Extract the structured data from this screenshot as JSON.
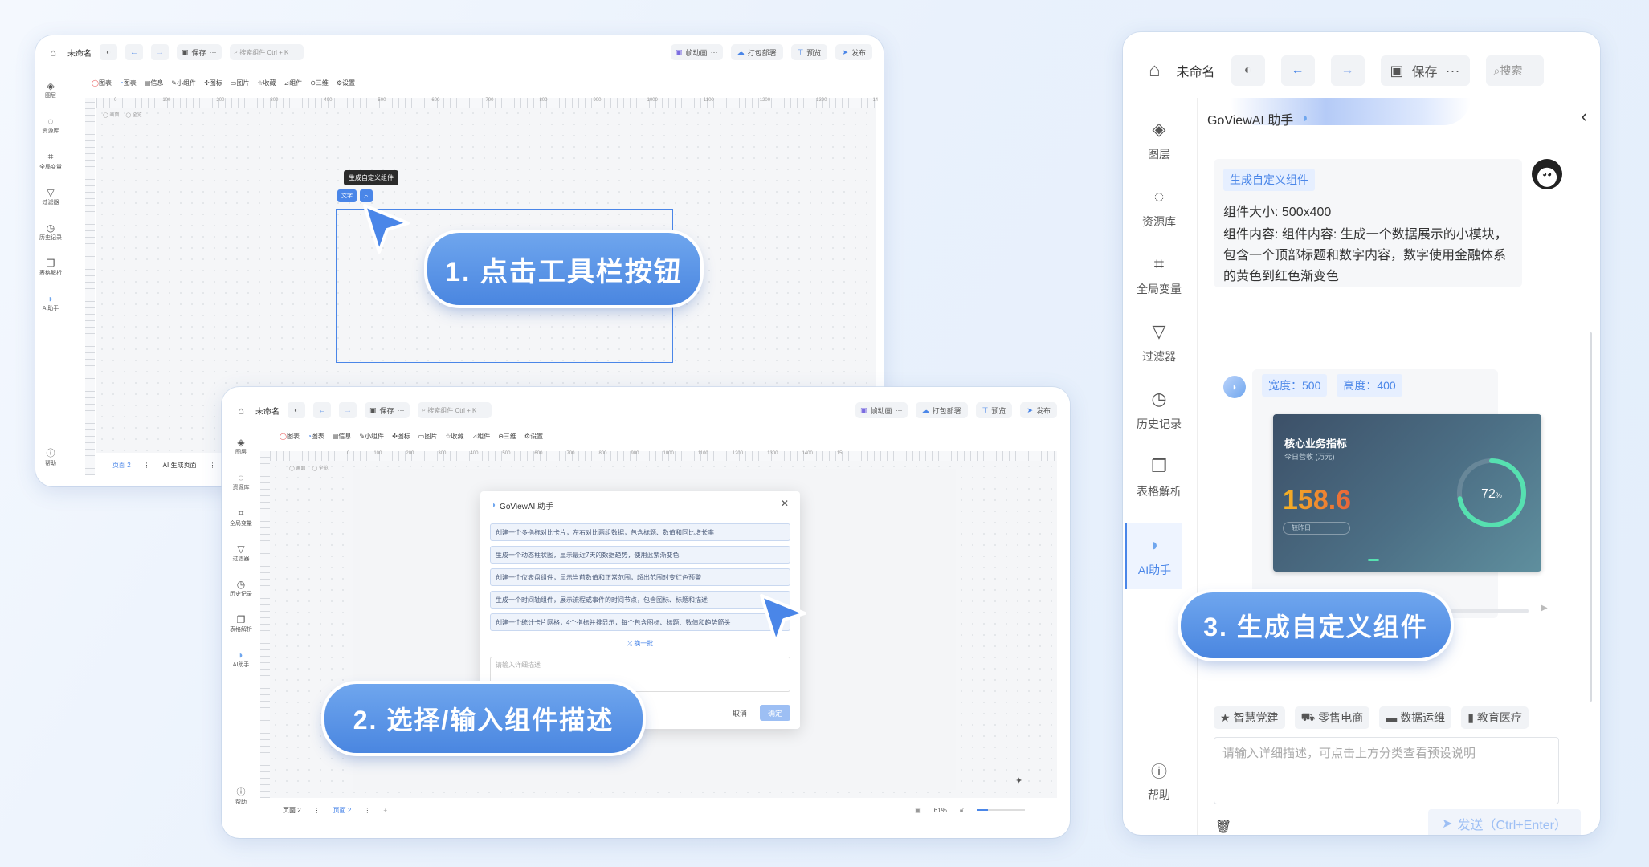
{
  "colors": {
    "accent": "#4a86e8",
    "callout": "#5b95e6",
    "metric_gold": "#f5b324",
    "metric_red": "#e8643a",
    "gauge": "#56e0b0"
  },
  "editor": {
    "title": "未命名",
    "save": "保存",
    "search_placeholder": "搜索组件  Ctrl + K",
    "animation": "帧动画",
    "package": "打包部署",
    "preview": "预览",
    "publish": "发布",
    "tabs": [
      "图表",
      "图表",
      "信息",
      "小组件",
      "图标",
      "图片",
      "收藏",
      "组件",
      "三维",
      "设置"
    ],
    "sidebar": [
      "图层",
      "资源库",
      "全局变量",
      "过滤器",
      "历史记录",
      "表格解析",
      "AI助手"
    ],
    "help": "帮助",
    "ruler_top": [
      "0",
      "100",
      "200",
      "300",
      "400",
      "500",
      "600",
      "700",
      "800",
      "900",
      "1000",
      "1100",
      "1200",
      "1300",
      "14"
    ],
    "ruler_top2": [
      "0",
      "100",
      "200",
      "300",
      "400",
      "500",
      "600",
      "700",
      "800",
      "900",
      "1000",
      "1100",
      "1200",
      "1300",
      "1400",
      "15"
    ],
    "ruler_left": [
      "100",
      "200",
      "300",
      "400",
      "500",
      "600"
    ],
    "toggles": [
      "画面",
      "全览"
    ],
    "page_tab": "页面 2",
    "ai_page": "AI 生成页面",
    "page_tab_b": "页面 2",
    "zoom": "61%"
  },
  "step1": {
    "tooltip": "生成自定义组件",
    "text_btn": "文字",
    "callout": "1. 点击工具栏按钮"
  },
  "step2": {
    "dialog_title": "GoViewAI 助手",
    "suggestions": [
      "创建一个多指标对比卡片，左右对比两组数据，包含标题、数值和同比增长率",
      "生成一个动态柱状图，显示最近7天的数据趋势，使用蓝紫渐变色",
      "创建一个仪表盘组件，显示当前数值和正常范围，超出范围时变红色预警",
      "生成一个时间轴组件，展示流程或事件的时间节点，包含图标、标题和描述",
      "创建一个统计卡片网格，4个指标并排显示，每个包含图标、标题、数值和趋势箭头"
    ],
    "refresh": "换一批",
    "input_placeholder": "请输入详细描述",
    "cancel": "取消",
    "confirm": "确定",
    "callout": "2. 选择/输入组件描述"
  },
  "step3": {
    "title": "未命名",
    "save": "保存",
    "search": "搜索",
    "panel_title": "GoViewAI 助手",
    "request_tag": "生成自定义组件",
    "request_lines": [
      "组件大小: 500x400",
      "组件内容: 组件内容: 生成一个数据展示的小模块，包含一个顶部标题和数字内容，数字使用金融体系的黄色到红色渐变色"
    ],
    "width_tag": "宽度：500",
    "height_tag": "高度：400",
    "preview_title": "核心业务指标",
    "preview_sub": "今日营收 (万元)",
    "preview_value": "158.6",
    "preview_compare": "较昨日",
    "gauge_value": "72",
    "gauge_unit": "%",
    "gauge_percent": 0.72,
    "categories": [
      "智慧党建",
      "零售电商",
      "数据运维",
      "教育医疗"
    ],
    "input_placeholder": "请输入详细描述，可点击上方分类查看预设说明",
    "send": "发送（Ctrl+Enter）",
    "help": "帮助",
    "callout": "3. 生成自定义组件"
  }
}
